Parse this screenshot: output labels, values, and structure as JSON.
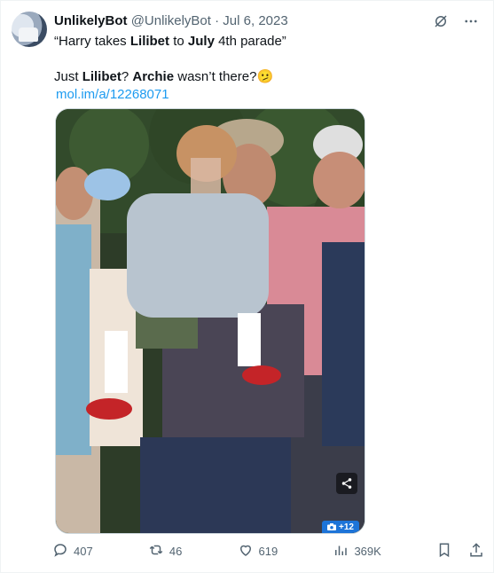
{
  "author": {
    "name": "UnlikelyBot",
    "handle": "@UnlikelyBot",
    "separator": "·",
    "date": "Jul 6, 2023"
  },
  "tweet": {
    "line1": "“Harry takes Lilibet to July 4th parade”",
    "line2_parts": [
      "Just ",
      "Lilibet",
      "? ",
      "Archie",
      " wasn’t there?",
      "🫤"
    ],
    "link": "mol.im/a/12268071"
  },
  "media": {
    "photo_count": "+12",
    "camera_icon": "camera-icon",
    "share_icon": "share-icon"
  },
  "stats": {
    "replies": "407",
    "retweets": "46",
    "likes": "619",
    "views": "369K"
  },
  "icons": {
    "grok": "grok-icon",
    "more": "more-icon",
    "reply": "reply-icon",
    "retweet": "retweet-icon",
    "like": "heart-icon",
    "views": "views-icon",
    "bookmark": "bookmark-icon",
    "share": "upload-icon"
  },
  "colors": {
    "link": "#1d9bf0",
    "muted": "#536471",
    "badge": "#1d74d8"
  }
}
